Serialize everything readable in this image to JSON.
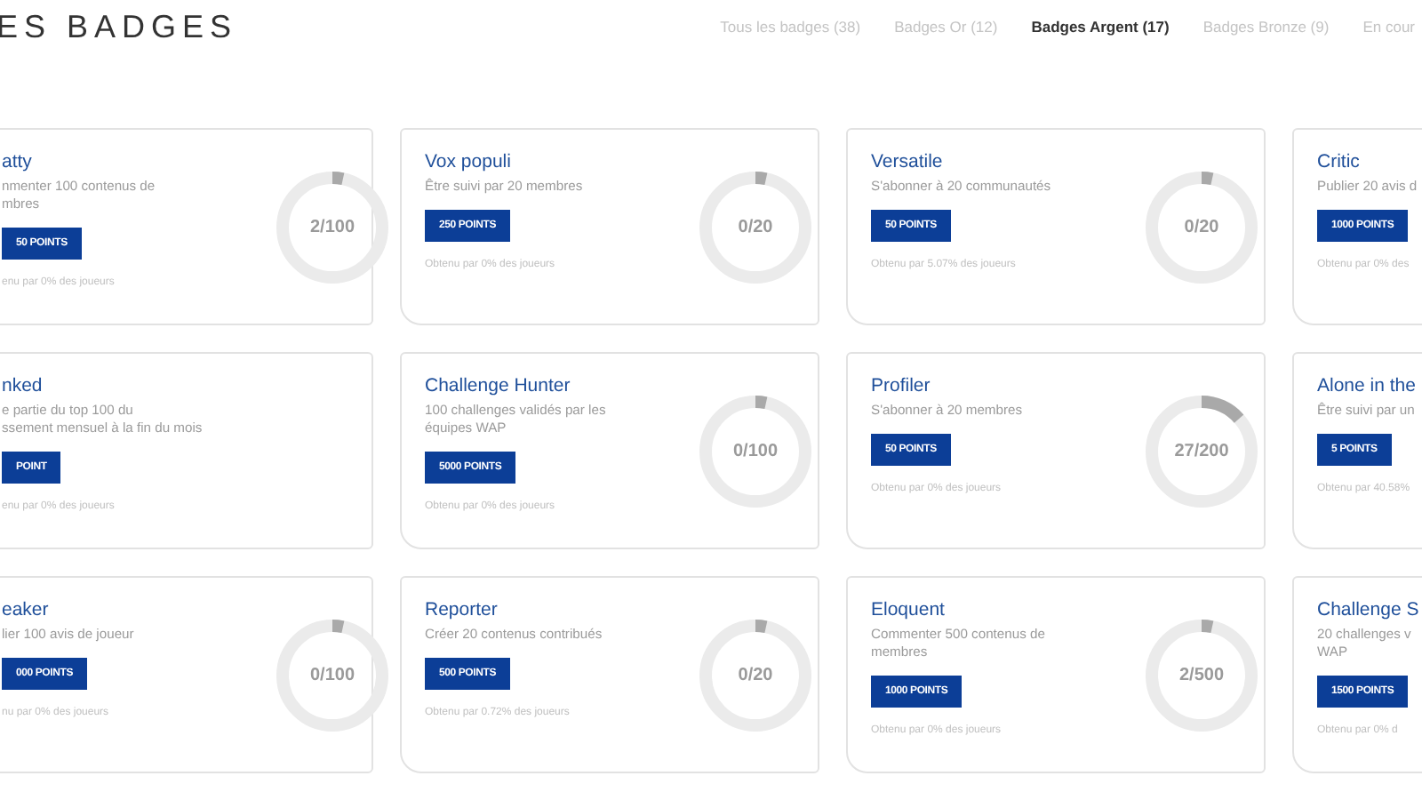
{
  "header": {
    "title": "ES BADGES"
  },
  "tabs": [
    {
      "label": "Tous les badges (38)",
      "selected": false
    },
    {
      "label": "Badges Or (12)",
      "selected": false
    },
    {
      "label": "Badges Argent (17)",
      "selected": true
    },
    {
      "label": "Badges Bronze (9)",
      "selected": false
    },
    {
      "label": "En cour",
      "selected": false
    }
  ],
  "badges": [
    {
      "title": "atty",
      "description": [
        "nmenter 100 contenus de",
        "mbres"
      ],
      "points": "50 POINTS",
      "obtained": "enu par 0% des joueurs",
      "progress": {
        "text": "2/100",
        "level": 0.02
      }
    },
    {
      "title": "Vox populi",
      "description": [
        "Être suivi par 20 membres"
      ],
      "points": "250 POINTS",
      "obtained": "Obtenu par 0% des joueurs",
      "progress": {
        "text": "0/20",
        "level": 0
      }
    },
    {
      "title": "Versatile",
      "description": [
        "S'abonner à 20 communautés"
      ],
      "points": "50 POINTS",
      "obtained": "Obtenu par 5.07% des joueurs",
      "progress": {
        "text": "0/20",
        "level": 0
      }
    },
    {
      "title": "Critic",
      "description": [
        "Publier 20 avis d"
      ],
      "points": "1000 POINTS",
      "obtained": "Obtenu par 0% des"
    },
    {
      "title": "nked",
      "description": [
        "e partie du top 100 du",
        "ssement mensuel à la fin du mois"
      ],
      "points": "POINT",
      "obtained": "enu par 0% des joueurs"
    },
    {
      "title": "Challenge Hunter",
      "description": [
        "100 challenges validés par les",
        "équipes WAP"
      ],
      "points": "5000 POINTS",
      "obtained": "Obtenu par 0% des joueurs",
      "progress": {
        "text": "0/100",
        "level": 0
      }
    },
    {
      "title": "Profiler",
      "description": [
        "S'abonner à 20 membres"
      ],
      "points": "50 POINTS",
      "obtained": "Obtenu par 0% des joueurs",
      "progress": {
        "text": "27/200",
        "level": 0.135
      }
    },
    {
      "title": "Alone in the",
      "description": [
        "Être suivi par un"
      ],
      "points": "5 POINTS",
      "obtained": "Obtenu par 40.58%"
    },
    {
      "title": "eaker",
      "description": [
        "lier 100 avis de joueur"
      ],
      "points": "000 POINTS",
      "obtained": "nu par 0% des joueurs",
      "progress": {
        "text": "0/100",
        "level": 0
      }
    },
    {
      "title": "Reporter",
      "description": [
        "Créer 20 contenus contribués"
      ],
      "points": "500 POINTS",
      "obtained": "Obtenu par 0.72% des joueurs",
      "progress": {
        "text": "0/20",
        "level": 0
      }
    },
    {
      "title": "Eloquent",
      "description": [
        "Commenter 500 contenus de",
        "membres"
      ],
      "points": "1000 POINTS",
      "obtained": "Obtenu par 0% des joueurs",
      "progress": {
        "text": "2/500",
        "level": 0.004
      }
    },
    {
      "title": "Challenge S",
      "description": [
        "20 challenges v",
        "WAP"
      ],
      "points": "1500 POINTS",
      "obtained": "Obtenu par 0% d"
    }
  ]
}
